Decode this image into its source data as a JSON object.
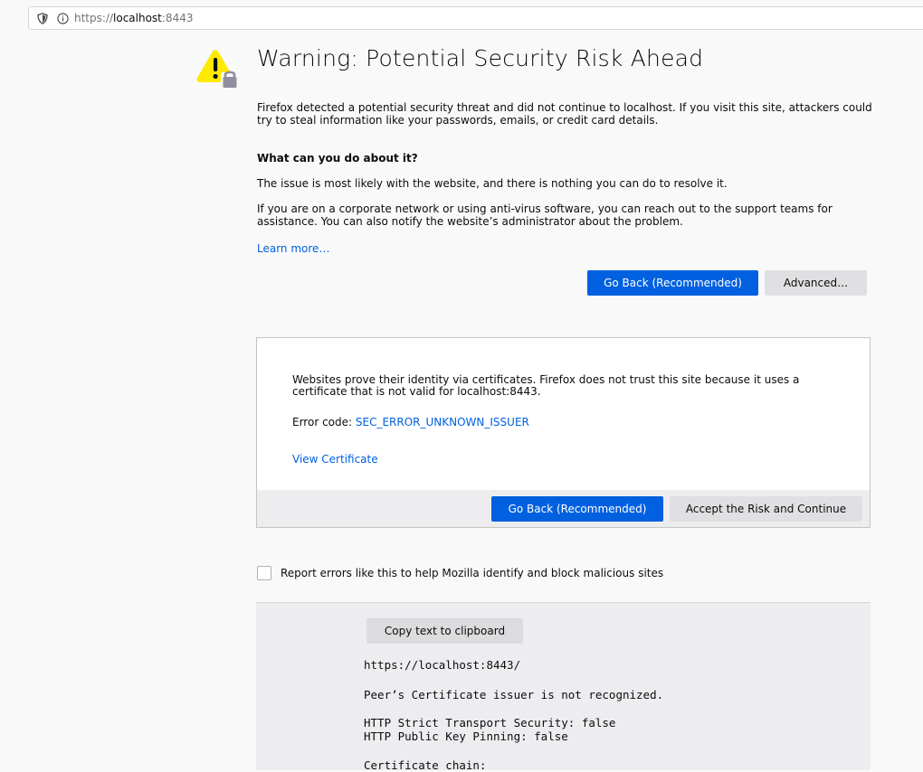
{
  "urlbar": {
    "proto": "https://",
    "host": "localhost",
    "port": ":8443"
  },
  "page": {
    "title": "Warning: Potential Security Risk Ahead",
    "intro": "Firefox detected a potential security threat and did not continue to localhost. If you visit this site, attackers could try to steal information like your passwords, emails, or credit card details.",
    "heading": "What can you do about it?",
    "p_issue": "The issue is most likely with the website, and there is nothing you can do to resolve it.",
    "p_corporate": "If you are on a corporate network or using anti-virus software, you can reach out to the support teams for assistance. You can also notify the website’s administrator about the problem.",
    "learn_more": "Learn more…",
    "go_back": "Go Back (Recommended)",
    "advanced": "Advanced…"
  },
  "advanced_panel": {
    "text": "Websites prove their identity via certificates. Firefox does not trust this site because it uses a certificate that is not valid for localhost:8443.",
    "error_prefix": "Error code: ",
    "error_code": "SEC_ERROR_UNKNOWN_ISSUER",
    "view_certificate": "View Certificate",
    "go_back": "Go Back (Recommended)",
    "accept": "Accept the Risk and Continue"
  },
  "report": {
    "label": "Report errors like this to help Mozilla identify and block malicious sites",
    "checked": false
  },
  "cert_details": {
    "copy_button": "Copy text to clipboard",
    "url": "https://localhost:8443/",
    "issuer_msg": "Peer’s Certificate issuer is not recognized.",
    "hsts": "HTTP Strict Transport Security: false",
    "hpkp": "HTTP Public Key Pinning: false",
    "chain": "Certificate chain:"
  },
  "colors": {
    "primary": "#0060df",
    "warning": "#ffe900",
    "lock": "#737373"
  }
}
